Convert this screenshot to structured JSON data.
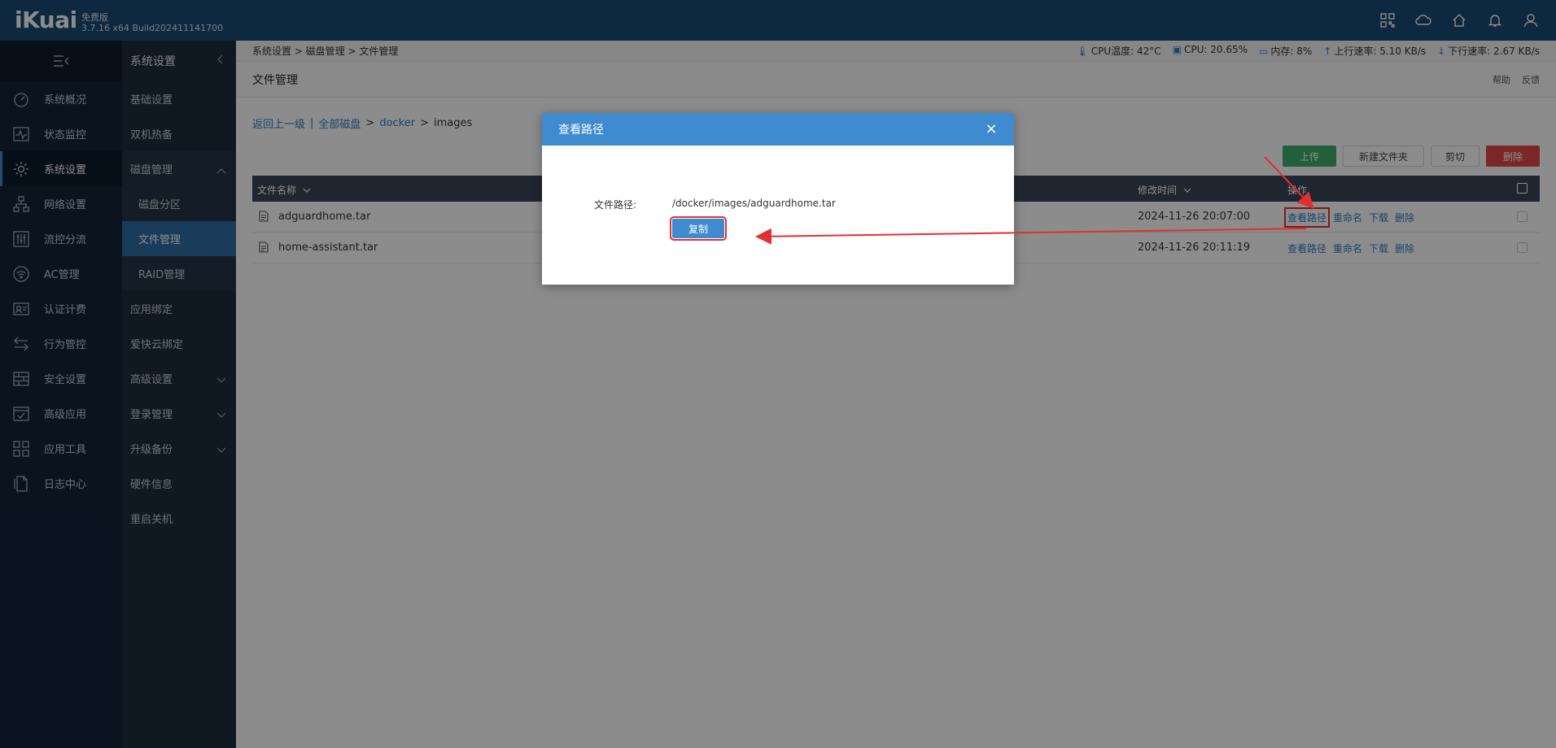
{
  "topbar": {
    "logo": "iKuai",
    "edition": "免费版",
    "build": "3.7.16 x64 Build202411141700",
    "icons": [
      "apps-icon",
      "cloud-icon",
      "home-icon",
      "bell-icon",
      "user-icon"
    ]
  },
  "leftnav": {
    "items": [
      {
        "label": "系统概况",
        "icon": "dashboard-icon"
      },
      {
        "label": "状态监控",
        "icon": "monitor-icon"
      },
      {
        "label": "系统设置",
        "icon": "gear-icon"
      },
      {
        "label": "网络设置",
        "icon": "network-icon"
      },
      {
        "label": "流控分流",
        "icon": "sliders-icon"
      },
      {
        "label": "AC管理",
        "icon": "wifi-icon"
      },
      {
        "label": "认证计费",
        "icon": "id-card-icon"
      },
      {
        "label": "行为管控",
        "icon": "swap-icon"
      },
      {
        "label": "安全设置",
        "icon": "firewall-icon"
      },
      {
        "label": "高级应用",
        "icon": "check-window-icon"
      },
      {
        "label": "应用工具",
        "icon": "tools-icon"
      },
      {
        "label": "日志中心",
        "icon": "log-icon"
      }
    ]
  },
  "subnav": {
    "title": "系统设置",
    "items": [
      {
        "label": "基础设置"
      },
      {
        "label": "双机热备"
      },
      {
        "label": "磁盘管理"
      },
      {
        "label": "磁盘分区"
      },
      {
        "label": "文件管理"
      },
      {
        "label": "RAID管理"
      },
      {
        "label": "应用绑定"
      },
      {
        "label": "爱快云绑定"
      },
      {
        "label": "高级设置"
      },
      {
        "label": "登录管理"
      },
      {
        "label": "升级备份"
      },
      {
        "label": "硬件信息"
      },
      {
        "label": "重启关机"
      }
    ]
  },
  "status": {
    "breadcrumb": "系统设置 > 磁盘管理 > 文件管理",
    "cpu_temp": "CPU温度: 42°C",
    "cpu": "CPU: 20.65%",
    "memory": "内存: 8%",
    "upload": "上行速率: 5.10 KB/s",
    "download": "下行速率: 2.67 KB/s"
  },
  "page": {
    "title": "文件管理",
    "help": "帮助",
    "feedback": "反馈"
  },
  "path": {
    "back": "返回上一级",
    "sep": "|",
    "all_disks": "全部磁盘",
    "gt1": ">",
    "docker": "docker",
    "gt2": ">",
    "current": "images"
  },
  "toolbar": {
    "upload": "上传",
    "new_folder": "新建文件夹",
    "cut": "剪切",
    "delete": "删除"
  },
  "table": {
    "col_name": "文件名称",
    "col_mtime": "修改时间",
    "col_ops": "操作",
    "rows": [
      {
        "name": "adguardhome.tar",
        "mtime": "2024-11-26 20:07:00"
      },
      {
        "name": "home-assistant.tar",
        "mtime": "2024-11-26 20:11:19"
      }
    ],
    "ops": {
      "view_path": "查看路径",
      "rename": "重命名",
      "download": "下载",
      "delete": "删除"
    }
  },
  "modal": {
    "title": "查看路径",
    "close": "×",
    "path_label": "文件路径:",
    "path_value": "/docker/images/adguardhome.tar",
    "copy": "复制"
  },
  "colors": {
    "topbar": "#1b4a74",
    "accent": "#3f8bd0",
    "annotation": "#e23030"
  }
}
